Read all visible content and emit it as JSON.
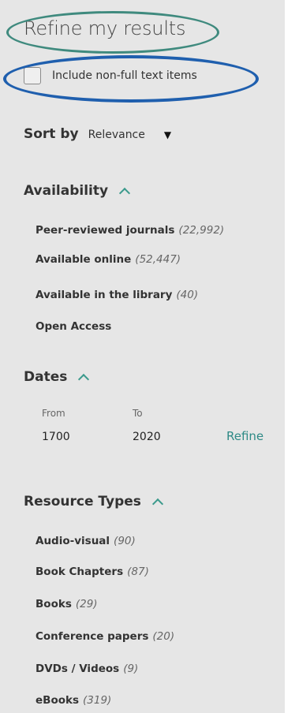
{
  "title": "Refine my results",
  "include_non_full_text": {
    "label": "Include non-full text items",
    "checked": false
  },
  "sort": {
    "label": "Sort by",
    "selected": "Relevance"
  },
  "availability": {
    "heading": "Availability",
    "items": [
      {
        "label": "Peer-reviewed journals",
        "count": "(22,992)"
      },
      {
        "label": "Available online",
        "count": "(52,447)"
      },
      {
        "label": "Available in the library",
        "count": "(40)"
      },
      {
        "label": "Open Access",
        "count": ""
      }
    ]
  },
  "dates": {
    "heading": "Dates",
    "from_label": "From",
    "to_label": "To",
    "from_value": "1700",
    "to_value": "2020",
    "refine_label": "Refine"
  },
  "resource_types": {
    "heading": "Resource Types",
    "items": [
      {
        "label": "Audio-visual",
        "count": "(90)"
      },
      {
        "label": "Book Chapters",
        "count": "(87)"
      },
      {
        "label": "Books",
        "count": "(29)"
      },
      {
        "label": "Conference papers",
        "count": "(20)"
      },
      {
        "label": "DVDs / Videos",
        "count": "(9)"
      },
      {
        "label": "eBooks",
        "count": "(319)"
      }
    ]
  },
  "colors": {
    "accent": "#3b9a8c",
    "annotation_teal": "#3f8a7e",
    "annotation_blue": "#1f5fae",
    "panel_bg": "#e6e6e6"
  }
}
